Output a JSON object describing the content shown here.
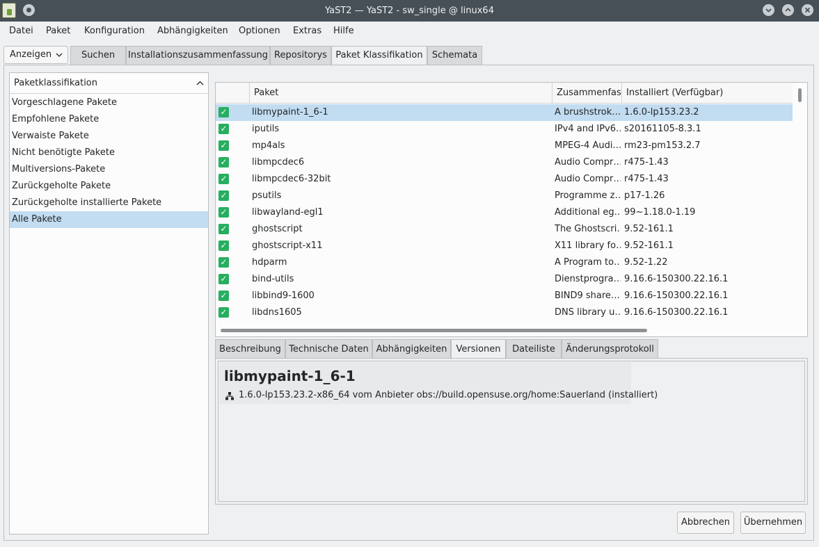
{
  "window": {
    "title": "YaST2 — YaST2 - sw_single @ linux64"
  },
  "menubar": [
    "Datei",
    "Paket",
    "Konfiguration",
    "Abhängigkeiten",
    "Optionen",
    "Extras",
    "Hilfe"
  ],
  "view_combo": "Anzeigen",
  "top_tabs": [
    "Suchen",
    "Installationszusammenfassung",
    "Repositorys",
    "Paket  Klassifikation",
    "Schemata"
  ],
  "active_top_tab": "Paket  Klassifikation",
  "left_panel": {
    "header": "Paketklassifikation",
    "items": [
      "Vorgeschlagene Pakete",
      "Empfohlene Pakete",
      "Verwaiste Pakete",
      "Nicht benötigte Pakete",
      "Multiversions-Pakete",
      "Zurückgeholte Pakete",
      "Zurückgeholte installierte Pakete",
      "Alle Pakete"
    ],
    "selected": "Alle Pakete"
  },
  "table": {
    "columns": [
      "",
      "Paket",
      "Zusammenfas",
      "Installiert (Verfügbar)"
    ],
    "rows": [
      {
        "name": "libmypaint-1_6-1",
        "summary": "A brushstrok…",
        "version": "1.6.0-lp153.23.2",
        "checked": true,
        "selected": true
      },
      {
        "name": "iputils",
        "summary": "IPv4 and IPv6…",
        "version": "s20161105-8.3.1",
        "checked": true
      },
      {
        "name": "mp4als",
        "summary": "MPEG-4 Audi…",
        "version": "rm23-pm153.2.7",
        "checked": true
      },
      {
        "name": "libmpcdec6",
        "summary": "Audio Compr…",
        "version": "r475-1.43",
        "checked": true
      },
      {
        "name": "libmpcdec6-32bit",
        "summary": "Audio Compr…",
        "version": "r475-1.43",
        "checked": true
      },
      {
        "name": "psutils",
        "summary": "Programme z…",
        "version": "p17-1.26",
        "checked": true
      },
      {
        "name": "libwayland-egl1",
        "summary": "Additional eg…",
        "version": "99~1.18.0-1.19",
        "checked": true
      },
      {
        "name": "ghostscript",
        "summary": "The Ghostscri…",
        "version": "9.52-161.1",
        "checked": true
      },
      {
        "name": "ghostscript-x11",
        "summary": "X11 library fo…",
        "version": "9.52-161.1",
        "checked": true
      },
      {
        "name": "hdparm",
        "summary": "A Program to…",
        "version": "9.52-1.22",
        "checked": true
      },
      {
        "name": "bind-utils",
        "summary": "Dienstprogra…",
        "version": "9.16.6-150300.22.16.1",
        "checked": true
      },
      {
        "name": "libbind9-1600",
        "summary": "BIND9 share…",
        "version": "9.16.6-150300.22.16.1",
        "checked": true
      },
      {
        "name": "libdns1605",
        "summary": "DNS library u…",
        "version": "9.16.6-150300.22.16.1",
        "checked": true
      }
    ]
  },
  "detail_tabs": [
    "Beschreibung",
    "Technische Daten",
    "Abhängigkeiten",
    "Versionen",
    "Dateiliste",
    "Änderungsprotokoll"
  ],
  "active_detail_tab": "Versionen",
  "detail": {
    "package_name": "libmypaint-1_6-1",
    "version_line": "1.6.0-lp153.23.2-x86_64 vom Anbieter obs://build.opensuse.org/home:Sauerland (installiert)"
  },
  "buttons": {
    "cancel": "Abbrechen",
    "accept": "Übernehmen"
  },
  "colors": {
    "titlebar": "#475057",
    "selection": "#c2dcf1",
    "checkbox": "#27ae60"
  }
}
